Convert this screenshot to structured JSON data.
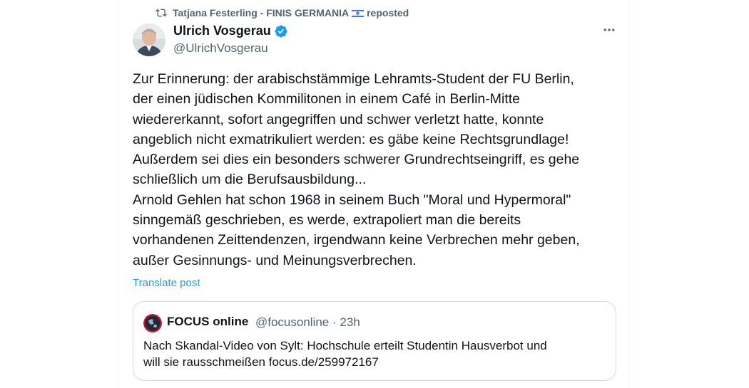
{
  "repost": {
    "by": "Tatjana Festerling - FINIS GERMANIA",
    "flag_icon": "israel-flag-icon",
    "label": "reposted"
  },
  "author": {
    "name": "Ulrich Vosgerau",
    "handle": "@UlrichVosgerau",
    "verified": true
  },
  "post": {
    "lines": [
      "Zur Erinnerung: der arabischstämmige Lehramts-Student der FU Berlin,",
      "der einen jüdischen Kommilitonen in einem Café in Berlin-Mitte",
      "wiedererkannt, sofort angegriffen und schwer verletzt hatte, konnte",
      "angeblich nicht exmatrikuliert werden: es gäbe keine Rechtsgrundlage!",
      "Außerdem sei dies ein besonders schwerer Grundrechtseingriff, es gehe",
      "schließlich um die Berufsausbildung...",
      "Arnold Gehlen hat schon 1968 in seinem Buch \"Moral und Hypermoral\"",
      "sinngemäß geschrieben, es werde, extrapoliert man die bereits",
      "vorhandenen Zeittendenzen, irgendwann keine Verbrechen mehr geben,",
      "außer Gesinnungs- und Meinungsverbrechen."
    ],
    "translate_label": "Translate post"
  },
  "quote": {
    "name": "FOCUS online",
    "handle": "@focusonline",
    "separator": "·",
    "time": "23h",
    "lines": [
      "Nach Skandal-Video von Sylt: Hochschule erteilt Studentin Hausverbot und",
      "will sie rausschmeißen focus.de/259972167"
    ]
  },
  "colors": {
    "accent": "#1d9bf0",
    "secondary_text": "#536471",
    "primary_text": "#0f1419",
    "border": "#cfd9de"
  }
}
